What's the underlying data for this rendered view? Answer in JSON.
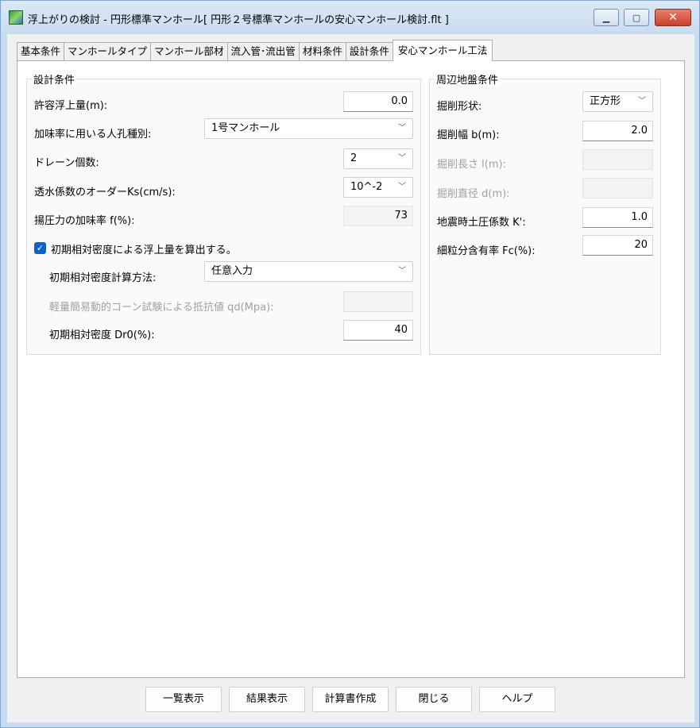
{
  "window": {
    "title": "浮上がりの検討 - 円形標準マンホール[ 円形２号標準マンホールの安心マンホール検討.flt ]"
  },
  "tabs": [
    {
      "label": "基本条件"
    },
    {
      "label": "マンホールタイプ"
    },
    {
      "label": "マンホール部材"
    },
    {
      "label": "流入管･流出管"
    },
    {
      "label": "材料条件"
    },
    {
      "label": "設計条件"
    },
    {
      "label": "安心マンホール工法"
    }
  ],
  "design": {
    "title": "設計条件",
    "allowable_uplift": {
      "label": "許容浮上量(m):",
      "value": "0.0"
    },
    "manhole_type": {
      "label": "加味率に用いる人孔種別:",
      "value": "1号マンホール"
    },
    "drain_count": {
      "label": "ドレーン個数:",
      "value": "2"
    },
    "permeability": {
      "label": "透水係数のオーダーKs(cm/s):",
      "value": "10^-2"
    },
    "uplift_rate": {
      "label": "揚圧力の加味率 f(%):",
      "value": "73"
    },
    "initial_density_check": {
      "label": "初期相対密度による浮上量を算出する。",
      "checked": true
    },
    "calc_method": {
      "label": "初期相対密度計算方法:",
      "value": "任意入力"
    },
    "cone_resistance": {
      "label": "軽量簡易動的コーン試験による抵抗値 qd(Mpa):",
      "value": ""
    },
    "initial_density": {
      "label": "初期相対密度 Dr0(%):",
      "value": "40"
    }
  },
  "ground": {
    "title": "周辺地盤条件",
    "excavation_shape": {
      "label": "掘削形状:",
      "value": "正方形"
    },
    "excavation_width": {
      "label": "掘削幅 b(m):",
      "value": "2.0"
    },
    "excavation_length": {
      "label": "掘削長さ l(m):",
      "value": ""
    },
    "excavation_diameter": {
      "label": "掘削直径 d(m):",
      "value": ""
    },
    "seismic_coefficient": {
      "label": "地震時土圧係数 K':",
      "value": "1.0"
    },
    "fines_content": {
      "label": "細粒分含有率 Fc(%):",
      "value": "20"
    }
  },
  "buttons": {
    "list": "一覧表示",
    "result": "結果表示",
    "report": "計算書作成",
    "close": "閉じる",
    "help": "ヘルプ"
  },
  "icons": {
    "combo_chevron": "chevron-down-icon",
    "app": "app-icon"
  }
}
